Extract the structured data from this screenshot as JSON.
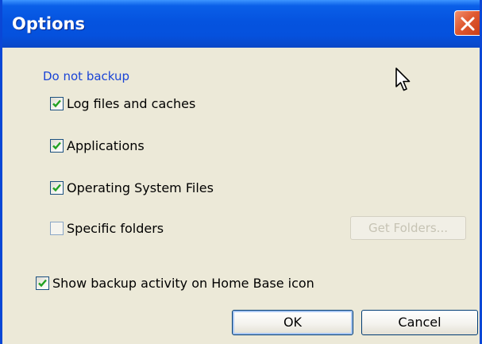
{
  "window": {
    "title": "Options"
  },
  "group": {
    "label": "Do not backup"
  },
  "checkboxes": [
    {
      "label": "Log files and caches",
      "checked": true
    },
    {
      "label": "Applications",
      "checked": true
    },
    {
      "label": "Operating System Files",
      "checked": true
    },
    {
      "label": "Specific folders",
      "checked": false
    }
  ],
  "get_folders_button": {
    "label": "Get Folders...",
    "enabled": false
  },
  "show_activity": {
    "label": "Show backup activity on Home Base icon",
    "checked": true
  },
  "buttons": {
    "ok": "OK",
    "cancel": "Cancel"
  },
  "icons": {
    "close": "close-icon",
    "check": "check-icon",
    "cursor": "mouse-pointer-icon"
  },
  "colors": {
    "title_bar": "#0553df",
    "close_button": "#e05a32",
    "group_label": "#1a44d6",
    "check_mark": "#21a121",
    "dialog_background": "#ece9d8"
  }
}
